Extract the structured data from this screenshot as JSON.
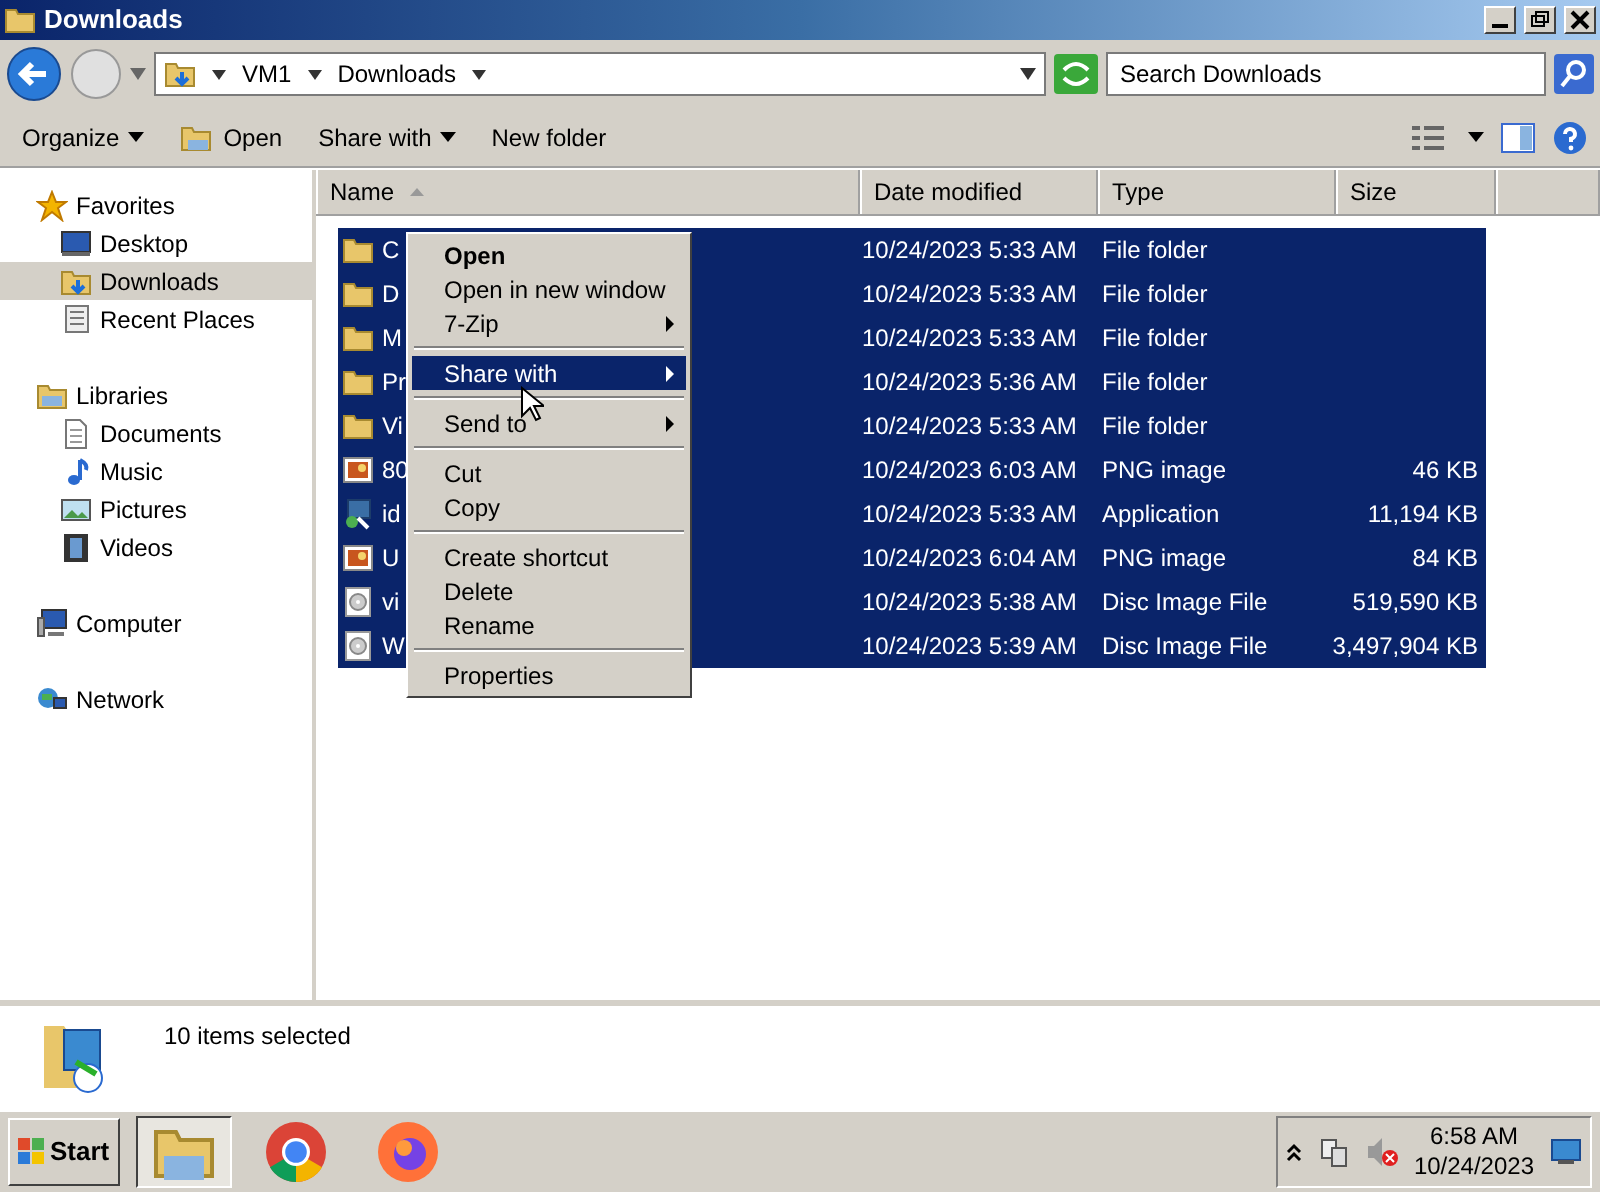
{
  "window": {
    "title": "Downloads"
  },
  "address": {
    "crumbs": [
      "VM1",
      "Downloads"
    ]
  },
  "search": {
    "placeholder": "Search Downloads"
  },
  "toolbar": [
    {
      "label": "Organize",
      "kind": "dropdown"
    },
    {
      "label": "Open",
      "kind": "open"
    },
    {
      "label": "Share with",
      "kind": "dropdown"
    },
    {
      "label": "New folder",
      "kind": "plain"
    }
  ],
  "nav": [
    {
      "label": "Favorites",
      "selected": false,
      "children": [
        {
          "label": "Desktop",
          "selected": false
        },
        {
          "label": "Downloads",
          "selected": true
        },
        {
          "label": "Recent Places",
          "selected": false
        }
      ]
    },
    {
      "label": "Libraries",
      "selected": false,
      "children": [
        {
          "label": "Documents",
          "selected": false
        },
        {
          "label": "Music",
          "selected": false
        },
        {
          "label": "Pictures",
          "selected": false
        },
        {
          "label": "Videos",
          "selected": false
        }
      ]
    },
    {
      "label": "Computer",
      "selected": false
    },
    {
      "label": "Network",
      "selected": false
    }
  ],
  "table": {
    "columns": [
      "Name",
      "Date modified",
      "Type",
      "Size"
    ],
    "rows": [
      {
        "kind": "folder",
        "name": "C",
        "date": "10/24/2023 5:33 AM",
        "type": "File folder",
        "selected": true
      },
      {
        "kind": "folder",
        "name": "D",
        "date": "10/24/2023 5:33 AM",
        "type": "File folder",
        "selected": true
      },
      {
        "kind": "folder",
        "name": "M",
        "date": "10/24/2023 5:33 AM",
        "type": "File folder",
        "selected": true
      },
      {
        "kind": "folder",
        "name": "Pr",
        "date": "10/24/2023 5:36 AM",
        "type": "File folder",
        "selected": true
      },
      {
        "kind": "folder",
        "name": "Vi",
        "date": "10/24/2023 5:33 AM",
        "type": "File folder",
        "selected": true
      },
      {
        "kind": "image",
        "name": "80",
        "date": "10/24/2023 6:03 AM",
        "type": "PNG image",
        "size": "46 KB",
        "selected": true
      },
      {
        "kind": "app",
        "name": "id",
        "date": "10/24/2023 5:33 AM",
        "type": "Application",
        "size": "11,194 KB",
        "selected": true
      },
      {
        "kind": "image",
        "name": "U",
        "date": "10/24/2023 6:04 AM",
        "type": "PNG image",
        "size": "84 KB",
        "selected": true
      },
      {
        "kind": "disc",
        "name": "vi",
        "date": "10/24/2023 5:38 AM",
        "type": "Disc Image File",
        "size": "519,590 KB",
        "selected": true
      },
      {
        "kind": "disc",
        "name": "W",
        "date": "10/24/2023 5:39 AM",
        "type": "Disc Image File",
        "size": "3,497,904 KB",
        "selected": true
      }
    ]
  },
  "context_menu": [
    [
      {
        "label": "Open",
        "default": true,
        "submenu": false,
        "selected": false
      },
      {
        "label": "Open in new window",
        "default": false,
        "submenu": false,
        "selected": false
      },
      {
        "label": "7-Zip",
        "default": false,
        "submenu": true,
        "selected": false
      }
    ],
    [
      {
        "label": "Share with",
        "default": false,
        "submenu": true,
        "selected": true
      }
    ],
    [
      {
        "label": "Send to",
        "default": false,
        "submenu": true,
        "selected": false
      }
    ],
    [
      {
        "label": "Cut",
        "default": false,
        "submenu": false,
        "selected": false
      },
      {
        "label": "Copy",
        "default": false,
        "submenu": false,
        "selected": false
      }
    ],
    [
      {
        "label": "Create shortcut",
        "default": false,
        "submenu": false,
        "selected": false
      },
      {
        "label": "Delete",
        "default": false,
        "submenu": false,
        "selected": false
      },
      {
        "label": "Rename",
        "default": false,
        "submenu": false,
        "selected": false
      }
    ],
    [
      {
        "label": "Properties",
        "default": false,
        "submenu": false,
        "selected": false
      }
    ]
  ],
  "status_bar": {
    "text": "10 items selected"
  },
  "taskbar": {
    "start": "Start",
    "apps": [
      {
        "kind": "explorer",
        "selected": true
      },
      {
        "kind": "chrome",
        "selected": false
      },
      {
        "kind": "firefox",
        "selected": false
      }
    ],
    "time": "6:58 AM",
    "date": "10/24/2023"
  }
}
